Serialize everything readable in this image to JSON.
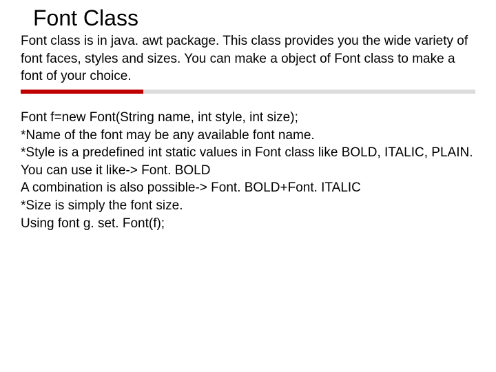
{
  "title": "Font Class",
  "intro": "Font class is in java. awt package. This class provides you the wide variety of font faces, styles and sizes. You can make a object of Font class to make a font of your choice.",
  "body_lines": [
    "Font f=new Font(String name, int style, int size);",
    "*Name of the font may be any available font name.",
    "*Style is a predefined int static values in Font class like BOLD, ITALIC, PLAIN. You can use it like-> Font. BOLD",
    "A combination is also possible-> Font. BOLD+Font. ITALIC",
    "*Size is simply the font size.",
    "Using font g. set. Font(f);"
  ],
  "colors": {
    "accent": "#c00000",
    "divider_gray": "#dcdcdc"
  }
}
